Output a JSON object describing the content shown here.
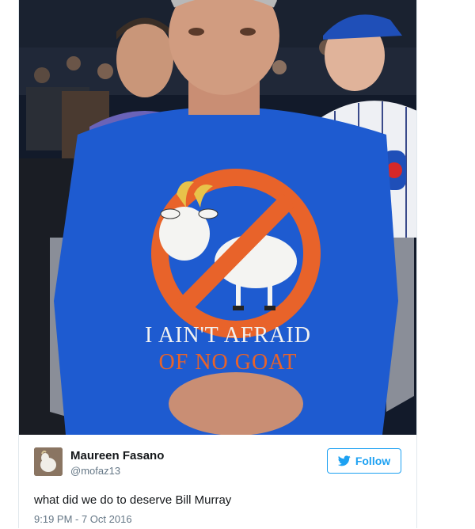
{
  "tweet": {
    "author_name": "Maureen Fasano",
    "author_handle": "@mofaz13",
    "follow_label": "Follow",
    "text": "what did we do to deserve Bill Murray",
    "timestamp": "9:19 PM - 7 Oct 2016"
  },
  "photo": {
    "shirt_text_line1": "I AIN'T AFRAID",
    "shirt_text_line2": "OF NO GOAT"
  },
  "icons": {
    "follow": "twitter-bird-icon",
    "avatar": "goat-avatar"
  },
  "colors": {
    "twitter_blue": "#1da1f2",
    "shirt_blue": "#1e5bd0",
    "no_sign_orange": "#e8632a"
  }
}
